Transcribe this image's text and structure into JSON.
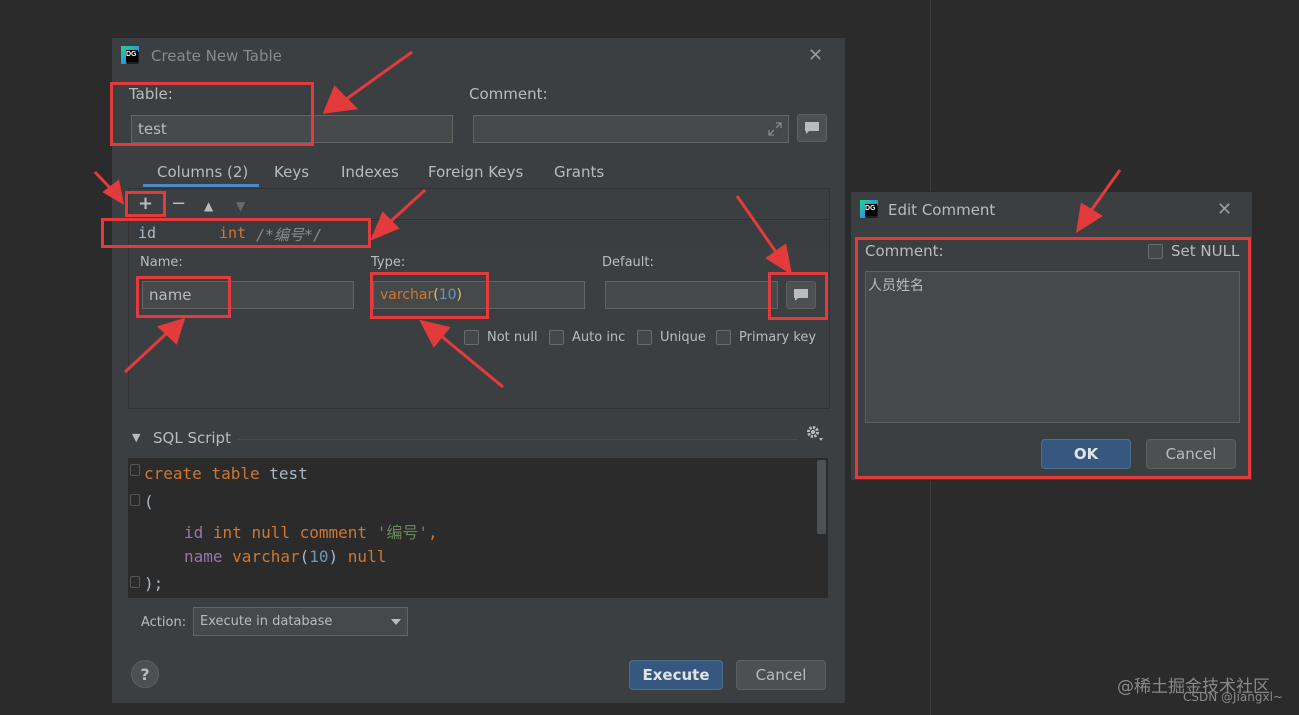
{
  "main_dialog": {
    "title": "Create New Table",
    "table_label": "Table:",
    "table_value": "test",
    "comment_label": "Comment:",
    "comment_value": "",
    "tabs": [
      {
        "label": "Columns (2)",
        "active": true
      },
      {
        "label": "Keys",
        "active": false
      },
      {
        "label": "Indexes",
        "active": false
      },
      {
        "label": "Foreign Keys",
        "active": false
      },
      {
        "label": "Grants",
        "active": false
      }
    ],
    "toolbar": {
      "add": "+",
      "remove": "−",
      "up": "▲",
      "down": "▼"
    },
    "column_row": {
      "name": "id",
      "type": "int",
      "comment": "/*编号*/"
    },
    "name_label": "Name:",
    "name_value": "name",
    "type_label": "Type:",
    "type_name": "varchar",
    "type_paren_open": "(",
    "type_length": "10",
    "type_paren_close": ")",
    "default_label": "Default:",
    "default_value": "",
    "checkboxes": [
      {
        "label": "Not null",
        "checked": false
      },
      {
        "label": "Auto inc",
        "checked": false
      },
      {
        "label": "Unique",
        "checked": false
      },
      {
        "label": "Primary key",
        "checked": false
      }
    ],
    "sql_script_label": "SQL Script",
    "sql_lines": [
      {
        "kw1": "create",
        "kw2": "table",
        "ident": "test"
      },
      {
        "text": "("
      },
      {
        "col": "id",
        "type": "int",
        "nul": "null",
        "cmt": "comment",
        "str": "'编号'",
        "tail": ","
      },
      {
        "col": "name",
        "type": "varchar",
        "po": "(",
        "num": "10",
        "pc": ")",
        "nul": "null"
      },
      {
        "text": ");"
      }
    ],
    "action_label": "Action:",
    "action_value": "Execute in database",
    "help": "?",
    "execute": "Execute",
    "cancel": "Cancel"
  },
  "edit_dialog": {
    "title": "Edit Comment",
    "comment_label": "Comment:",
    "set_null": "Set NULL",
    "comment_text": "人员姓名",
    "ok": "OK",
    "cancel": "Cancel"
  },
  "watermark": {
    "juejin": "@稀土掘金技术社区",
    "csdn": "CSDN @Jiangxl~"
  },
  "colors": {
    "annotation": "#e33b3b",
    "keyword": "#cc7832",
    "number": "#6897bb",
    "string": "#6a8759",
    "primary_button": "#365880"
  }
}
